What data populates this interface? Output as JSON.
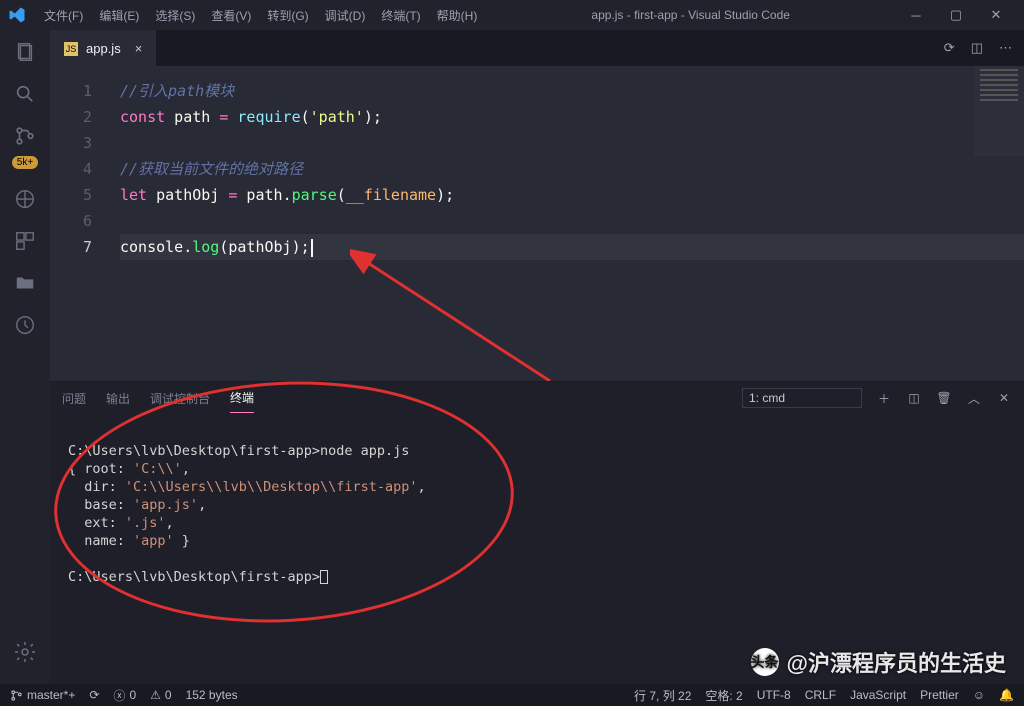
{
  "menu": {
    "file": "文件(F)",
    "edit": "编辑(E)",
    "select": "选择(S)",
    "view": "查看(V)",
    "goto": "转到(G)",
    "debug": "调试(D)",
    "terminal": "终端(T)",
    "help": "帮助(H)"
  },
  "title": "app.js - first-app - Visual Studio Code",
  "activity": {
    "badge": "5k+"
  },
  "tab": {
    "filename": "app.js",
    "icon": "JS"
  },
  "gutter": [
    "1",
    "2",
    "3",
    "4",
    "5",
    "6",
    "7"
  ],
  "code": {
    "l1_comment": "//引入path模块",
    "l2_const": "const",
    "l2_var": " path ",
    "l2_eq": "=",
    "l2_req": " require",
    "l2_paren_o": "(",
    "l2_str": "'path'",
    "l2_paren_c": ")",
    "l2_semi": ";",
    "l4_comment": "//获取当前文件的绝对路径",
    "l5_let": "let",
    "l5_var": " pathObj ",
    "l5_eq": "=",
    "l5_path": " path",
    "l5_dot": ".",
    "l5_parse": "parse",
    "l5_po": "(",
    "l5_fn": "__filename",
    "l5_pc": ")",
    "l5_semi": ";",
    "l7_console": "console",
    "l7_dot": ".",
    "l7_log": "log",
    "l7_po": "(",
    "l7_arg": "pathObj",
    "l7_pc": ")",
    "l7_semi": ";"
  },
  "panel_tabs": {
    "problems": "问题",
    "output": "输出",
    "debug_console": "调试控制台",
    "terminal": "终端"
  },
  "panel_select": "1: cmd",
  "terminal": {
    "line1": "C:\\Users\\lvb\\Desktop\\first-app>node app.js",
    "line2a": "{ root: ",
    "line2b": "'C:\\\\'",
    "line2c": ",",
    "line3a": "  dir: ",
    "line3b": "'C:\\\\Users\\\\lvb\\\\Desktop\\\\first-app'",
    "line3c": ",",
    "line4a": "  base: ",
    "line4b": "'app.js'",
    "line4c": ",",
    "line5a": "  ext: ",
    "line5b": "'.js'",
    "line5c": ",",
    "line6a": "  name: ",
    "line6b": "'app'",
    "line6c": " }",
    "line8": "C:\\Users\\lvb\\Desktop\\first-app>"
  },
  "status": {
    "branch": "master*+",
    "errors": "0",
    "warnings": "0",
    "bytes": "152 bytes",
    "cursor": "行 7, 列 22",
    "spaces": "空格: 2",
    "encoding": "UTF-8",
    "eol": "CRLF",
    "lang": "JavaScript",
    "prettier": "Prettier",
    "smile": "☺"
  },
  "watermark": {
    "brand": "头条",
    "text": "@沪漂程序员的生活史"
  }
}
